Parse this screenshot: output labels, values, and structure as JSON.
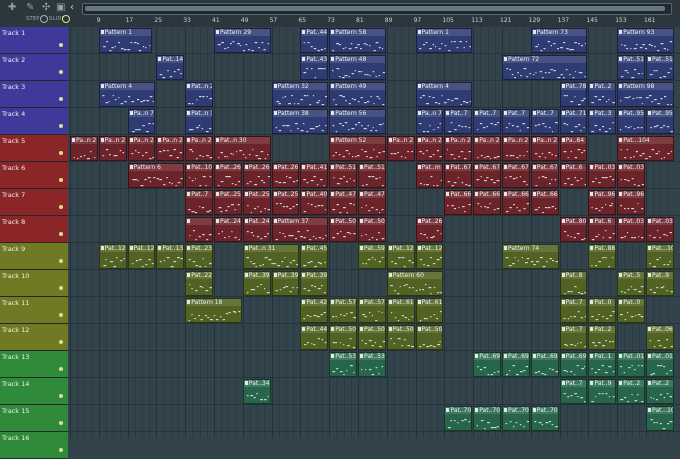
{
  "toolbar": {
    "icons": [
      "plus-icon",
      "pencil-icon",
      "paint-icon",
      "mute-icon"
    ],
    "snap_label": "STEP",
    "glide_label": "SLIDE",
    "scroll_left": "‹"
  },
  "ruler": {
    "bars": [
      "9",
      "17",
      "25",
      "33",
      "41",
      "49",
      "57",
      "65",
      "73",
      "81",
      "89",
      "97",
      "105",
      "113",
      "121",
      "129",
      "137",
      "145",
      "153",
      "161"
    ]
  },
  "colors": {
    "blue": "#3f3a9a",
    "red": "#8a2628",
    "olive": "#6f7a22",
    "green": "#2f8a3a",
    "clip_blue": "#2f3c73",
    "clip_red": "#6c232a",
    "clip_olive": "#516222",
    "clip_green": "#27664a"
  },
  "tracks": [
    {
      "name": "Track 1",
      "color": "blue"
    },
    {
      "name": "Track 2",
      "color": "blue"
    },
    {
      "name": "Track 3",
      "color": "blue"
    },
    {
      "name": "Track 4",
      "color": "blue"
    },
    {
      "name": "Track 5",
      "color": "red"
    },
    {
      "name": "Track 6",
      "color": "red"
    },
    {
      "name": "Track 7",
      "color": "red"
    },
    {
      "name": "Track 8",
      "color": "red"
    },
    {
      "name": "Track 9",
      "color": "olive"
    },
    {
      "name": "Track 10",
      "color": "olive"
    },
    {
      "name": "Track 11",
      "color": "olive"
    },
    {
      "name": "Track 12",
      "color": "olive"
    },
    {
      "name": "Track 13",
      "color": "green"
    },
    {
      "name": "Track 14",
      "color": "green"
    },
    {
      "name": "Track 15",
      "color": "green"
    },
    {
      "name": "Track 16",
      "color": "green"
    }
  ],
  "clips": [
    {
      "track": 0,
      "start": 9,
      "len": 15,
      "label": "Pattern 1"
    },
    {
      "track": 0,
      "start": 41,
      "len": 16,
      "label": "Pattern 29"
    },
    {
      "track": 0,
      "start": 65,
      "len": 8,
      "label": "Pat..44"
    },
    {
      "track": 0,
      "start": 73,
      "len": 16,
      "label": "Pattern 58"
    },
    {
      "track": 0,
      "start": 97,
      "len": 16,
      "label": "Pattern 1"
    },
    {
      "track": 0,
      "start": 129,
      "len": 16,
      "label": "Pattern 73"
    },
    {
      "track": 0,
      "start": 153,
      "len": 16,
      "label": "Pattern 93"
    },
    {
      "track": 1,
      "start": 25,
      "len": 8,
      "label": "Pat..14"
    },
    {
      "track": 1,
      "start": 65,
      "len": 8,
      "label": "Pat..43"
    },
    {
      "track": 1,
      "start": 73,
      "len": 16,
      "label": "Pattern 48"
    },
    {
      "track": 1,
      "start": 121,
      "len": 24,
      "label": "Pattern 72"
    },
    {
      "track": 1,
      "start": 153,
      "len": 8,
      "label": "Pat..51"
    },
    {
      "track": 1,
      "start": 161,
      "len": 8,
      "label": "Pat..51"
    },
    {
      "track": 2,
      "start": 9,
      "len": 16,
      "label": "Pattern 4"
    },
    {
      "track": 2,
      "start": 33,
      "len": 8,
      "label": "Pat..n 20"
    },
    {
      "track": 2,
      "start": 57,
      "len": 16,
      "label": "Pattern 32"
    },
    {
      "track": 2,
      "start": 73,
      "len": 16,
      "label": "Pattern 49"
    },
    {
      "track": 2,
      "start": 97,
      "len": 16,
      "label": "Pattern 4"
    },
    {
      "track": 2,
      "start": 137,
      "len": 8,
      "label": "Pat..78"
    },
    {
      "track": 2,
      "start": 145,
      "len": 8,
      "label": "Pat..2"
    },
    {
      "track": 2,
      "start": 153,
      "len": 16,
      "label": "Pattern 98"
    },
    {
      "track": 3,
      "start": 17,
      "len": 8,
      "label": "Pa..n 7"
    },
    {
      "track": 3,
      "start": 33,
      "len": 8,
      "label": "Pat..n 16"
    },
    {
      "track": 3,
      "start": 57,
      "len": 16,
      "label": "Pattern 38"
    },
    {
      "track": 3,
      "start": 73,
      "len": 16,
      "label": "Pattern 56"
    },
    {
      "track": 3,
      "start": 97,
      "len": 8,
      "label": "Pa..n 7"
    },
    {
      "track": 3,
      "start": 105,
      "len": 8,
      "label": "Pat..7"
    },
    {
      "track": 3,
      "start": 113,
      "len": 8,
      "label": "Pat..7"
    },
    {
      "track": 3,
      "start": 121,
      "len": 8,
      "label": "Pat..7"
    },
    {
      "track": 3,
      "start": 129,
      "len": 8,
      "label": "Pat..7"
    },
    {
      "track": 3,
      "start": 137,
      "len": 8,
      "label": "Pat..71"
    },
    {
      "track": 3,
      "start": 145,
      "len": 8,
      "label": "Pat..3"
    },
    {
      "track": 3,
      "start": 153,
      "len": 8,
      "label": "Pat..95"
    },
    {
      "track": 3,
      "start": 161,
      "len": 8,
      "label": "Pat..95"
    },
    {
      "track": 4,
      "start": 1,
      "len": 8,
      "label": "Pa..n 2"
    },
    {
      "track": 4,
      "start": 9,
      "len": 8,
      "label": "Pa..n 2"
    },
    {
      "track": 4,
      "start": 17,
      "len": 8,
      "label": "Pa..n 2"
    },
    {
      "track": 4,
      "start": 25,
      "len": 8,
      "label": "Pa..n 2"
    },
    {
      "track": 4,
      "start": 33,
      "len": 8,
      "label": "Pa..n 2"
    },
    {
      "track": 4,
      "start": 41,
      "len": 16,
      "label": "Pat..n 30"
    },
    {
      "track": 4,
      "start": 73,
      "len": 16,
      "label": "Pattern 52"
    },
    {
      "track": 4,
      "start": 89,
      "len": 8,
      "label": "Pa..n 2"
    },
    {
      "track": 4,
      "start": 97,
      "len": 8,
      "label": "Pa..n 2"
    },
    {
      "track": 4,
      "start": 105,
      "len": 8,
      "label": "Pa..n 2"
    },
    {
      "track": 4,
      "start": 113,
      "len": 8,
      "label": "Pa..n 2"
    },
    {
      "track": 4,
      "start": 121,
      "len": 8,
      "label": "Pa..n 2"
    },
    {
      "track": 4,
      "start": 129,
      "len": 8,
      "label": "Pa..n 2"
    },
    {
      "track": 4,
      "start": 137,
      "len": 8,
      "label": "Pa..84"
    },
    {
      "track": 4,
      "start": 153,
      "len": 16,
      "label": "Pat...104"
    },
    {
      "track": 5,
      "start": 17,
      "len": 16,
      "label": "Pattern 6"
    },
    {
      "track": 5,
      "start": 33,
      "len": 8,
      "label": "Pat..10"
    },
    {
      "track": 5,
      "start": 41,
      "len": 8,
      "label": "Pat..26"
    },
    {
      "track": 5,
      "start": 49,
      "len": 8,
      "label": "Pat..26"
    },
    {
      "track": 5,
      "start": 57,
      "len": 8,
      "label": "Pat..26"
    },
    {
      "track": 5,
      "start": 65,
      "len": 8,
      "label": "Pat..41"
    },
    {
      "track": 5,
      "start": 73,
      "len": 8,
      "label": "Pat..51"
    },
    {
      "track": 5,
      "start": 81,
      "len": 8,
      "label": "Pat..51"
    },
    {
      "track": 5,
      "start": 97,
      "len": 8,
      "label": "Pat..m 6"
    },
    {
      "track": 5,
      "start": 105,
      "len": 8,
      "label": "Pat..67"
    },
    {
      "track": 5,
      "start": 113,
      "len": 8,
      "label": "Pat..67"
    },
    {
      "track": 5,
      "start": 121,
      "len": 8,
      "label": "Pat..67"
    },
    {
      "track": 5,
      "start": 129,
      "len": 8,
      "label": "Pat..67"
    },
    {
      "track": 5,
      "start": 137,
      "len": 8,
      "label": "Pat..6"
    },
    {
      "track": 5,
      "start": 145,
      "len": 8,
      "label": "Pat..03"
    },
    {
      "track": 5,
      "start": 153,
      "len": 8,
      "label": "Pat..03"
    },
    {
      "track": 6,
      "start": 33,
      "len": 8,
      "label": "Pat..7"
    },
    {
      "track": 6,
      "start": 41,
      "len": 8,
      "label": "Pat..25"
    },
    {
      "track": 6,
      "start": 49,
      "len": 8,
      "label": "Pat..25"
    },
    {
      "track": 6,
      "start": 57,
      "len": 8,
      "label": "Pat..25"
    },
    {
      "track": 6,
      "start": 65,
      "len": 8,
      "label": "Pat..40"
    },
    {
      "track": 6,
      "start": 73,
      "len": 8,
      "label": "Pat..47"
    },
    {
      "track": 6,
      "start": 81,
      "len": 8,
      "label": "Pat..47"
    },
    {
      "track": 6,
      "start": 105,
      "len": 8,
      "label": "Pat..66"
    },
    {
      "track": 6,
      "start": 113,
      "len": 8,
      "label": "Pat..66"
    },
    {
      "track": 6,
      "start": 121,
      "len": 8,
      "label": "Pat..66"
    },
    {
      "track": 6,
      "start": 129,
      "len": 8,
      "label": "Pat..66"
    },
    {
      "track": 6,
      "start": 145,
      "len": 8,
      "label": "Pat..96"
    },
    {
      "track": 6,
      "start": 153,
      "len": 8,
      "label": "Pat..96"
    },
    {
      "track": 7,
      "start": 33,
      "len": 8,
      "label": ""
    },
    {
      "track": 7,
      "start": 41,
      "len": 8,
      "label": "Pat..24"
    },
    {
      "track": 7,
      "start": 49,
      "len": 8,
      "label": "Pat..24"
    },
    {
      "track": 7,
      "start": 57,
      "len": 16,
      "label": "Pattern 37"
    },
    {
      "track": 7,
      "start": 73,
      "len": 8,
      "label": "Pat..50"
    },
    {
      "track": 7,
      "start": 81,
      "len": 8,
      "label": "Pat..50"
    },
    {
      "track": 7,
      "start": 97,
      "len": 8,
      "label": "Pat..26"
    },
    {
      "track": 7,
      "start": 137,
      "len": 8,
      "label": "Pat..80"
    },
    {
      "track": 7,
      "start": 145,
      "len": 8,
      "label": "Pat..6"
    },
    {
      "track": 7,
      "start": 153,
      "len": 8,
      "label": "Pat..03"
    },
    {
      "track": 7,
      "start": 161,
      "len": 8,
      "label": "Pat..03"
    },
    {
      "track": 8,
      "start": 9,
      "len": 8,
      "label": "Pat..12"
    },
    {
      "track": 8,
      "start": 17,
      "len": 8,
      "label": "Pat..12"
    },
    {
      "track": 8,
      "start": 25,
      "len": 8,
      "label": "Pat..13"
    },
    {
      "track": 8,
      "start": 33,
      "len": 8,
      "label": "Pat..23"
    },
    {
      "track": 8,
      "start": 49,
      "len": 16,
      "label": "Pat..n 31"
    },
    {
      "track": 8,
      "start": 65,
      "len": 8,
      "label": "Pat..45"
    },
    {
      "track": 8,
      "start": 81,
      "len": 8,
      "label": "Pat..59"
    },
    {
      "track": 8,
      "start": 89,
      "len": 8,
      "label": "Pat..12"
    },
    {
      "track": 8,
      "start": 97,
      "len": 8,
      "label": "Pat..12"
    },
    {
      "track": 8,
      "start": 121,
      "len": 16,
      "label": "Pattern 74"
    },
    {
      "track": 8,
      "start": 145,
      "len": 8,
      "label": "Pat..88"
    },
    {
      "track": 8,
      "start": 161,
      "len": 8,
      "label": "Pat...105"
    },
    {
      "track": 9,
      "start": 33,
      "len": 8,
      "label": "Pat..22"
    },
    {
      "track": 9,
      "start": 49,
      "len": 8,
      "label": "Pat..39"
    },
    {
      "track": 9,
      "start": 57,
      "len": 8,
      "label": "Pat..39"
    },
    {
      "track": 9,
      "start": 65,
      "len": 8,
      "label": "Pat..39"
    },
    {
      "track": 9,
      "start": 89,
      "len": 16,
      "label": "Pattern 60"
    },
    {
      "track": 9,
      "start": 137,
      "len": 8,
      "label": "Pat..8"
    },
    {
      "track": 9,
      "start": 153,
      "len": 8,
      "label": "Pat..5"
    },
    {
      "track": 9,
      "start": 161,
      "len": 8,
      "label": "Pat..9"
    },
    {
      "track": 10,
      "start": 33,
      "len": 16,
      "label": "Pattern 18"
    },
    {
      "track": 10,
      "start": 65,
      "len": 8,
      "label": "Pat..42"
    },
    {
      "track": 10,
      "start": 73,
      "len": 8,
      "label": "Pat..57"
    },
    {
      "track": 10,
      "start": 81,
      "len": 8,
      "label": "Pat..57"
    },
    {
      "track": 10,
      "start": 89,
      "len": 8,
      "label": "Pat..61"
    },
    {
      "track": 10,
      "start": 97,
      "len": 8,
      "label": "Pat..61"
    },
    {
      "track": 10,
      "start": 137,
      "len": 8,
      "label": "Pat..7"
    },
    {
      "track": 10,
      "start": 145,
      "len": 8,
      "label": "Pat..0"
    },
    {
      "track": 10,
      "start": 153,
      "len": 8,
      "label": "Pat..0"
    },
    {
      "track": 11,
      "start": 65,
      "len": 8,
      "label": "Pat..44"
    },
    {
      "track": 11,
      "start": 73,
      "len": 8,
      "label": "Pat..50"
    },
    {
      "track": 11,
      "start": 81,
      "len": 8,
      "label": "Pat..50"
    },
    {
      "track": 11,
      "start": 89,
      "len": 8,
      "label": "Pat..50"
    },
    {
      "track": 11,
      "start": 97,
      "len": 8,
      "label": "Pat..50"
    },
    {
      "track": 11,
      "start": 137,
      "len": 8,
      "label": "Pat..7"
    },
    {
      "track": 11,
      "start": 145,
      "len": 8,
      "label": "Pat..2"
    },
    {
      "track": 11,
      "start": 161,
      "len": 8,
      "label": "Pat..06"
    },
    {
      "track": 12,
      "start": 73,
      "len": 8,
      "label": "Pat..53"
    },
    {
      "track": 12,
      "start": 81,
      "len": 8,
      "label": "Pat..53"
    },
    {
      "track": 12,
      "start": 113,
      "len": 8,
      "label": "Pat..69"
    },
    {
      "track": 12,
      "start": 121,
      "len": 8,
      "label": "Pat..69"
    },
    {
      "track": 12,
      "start": 129,
      "len": 8,
      "label": "Pat..69"
    },
    {
      "track": 12,
      "start": 137,
      "len": 8,
      "label": "Pat..69"
    },
    {
      "track": 12,
      "start": 145,
      "len": 8,
      "label": "Pat..1"
    },
    {
      "track": 12,
      "start": 153,
      "len": 8,
      "label": "Pat..01"
    },
    {
      "track": 12,
      "start": 161,
      "len": 8,
      "label": "Pat..01"
    },
    {
      "track": 13,
      "start": 49,
      "len": 8,
      "label": "Pat..34"
    },
    {
      "track": 13,
      "start": 137,
      "len": 8,
      "label": "Pat..7"
    },
    {
      "track": 13,
      "start": 145,
      "len": 8,
      "label": "Pat..9"
    },
    {
      "track": 13,
      "start": 153,
      "len": 8,
      "label": "Pat..2"
    },
    {
      "track": 13,
      "start": 161,
      "len": 8,
      "label": "Pat..2"
    },
    {
      "track": 14,
      "start": 105,
      "len": 8,
      "label": "Pat..70"
    },
    {
      "track": 14,
      "start": 113,
      "len": 8,
      "label": "Pat..70"
    },
    {
      "track": 14,
      "start": 121,
      "len": 8,
      "label": "Pat..70"
    },
    {
      "track": 14,
      "start": 129,
      "len": 8,
      "label": "Pat..70"
    },
    {
      "track": 14,
      "start": 161,
      "len": 8,
      "label": "Pat...107"
    }
  ]
}
